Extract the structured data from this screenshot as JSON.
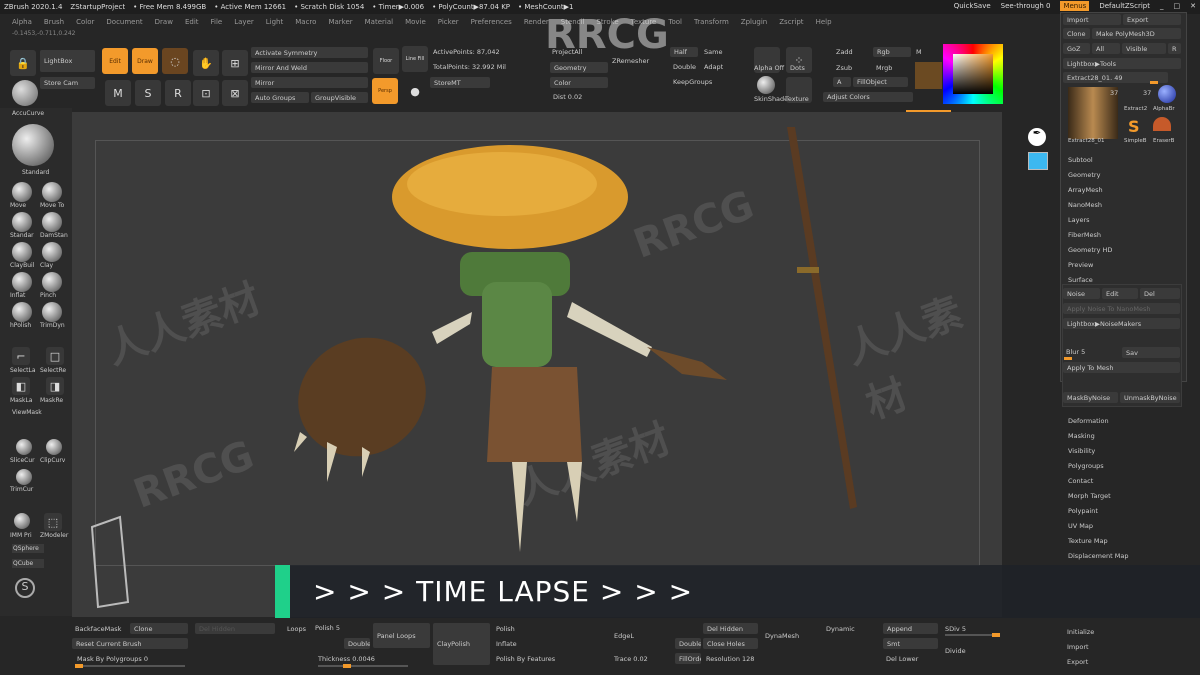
{
  "titlebar": {
    "app": "ZBrush 2020.1.4",
    "project": "ZStartupProject",
    "free_mem": "• Free Mem 8.499GB",
    "active_mem": "• Active Mem 12661",
    "scratch": "• Scratch Disk 1054",
    "timer": "• Timer▶0.006",
    "polycount": "• PolyCount▶87.04 KP",
    "meshcount": "• MeshCount▶1",
    "quicksave": "QuickSave",
    "seethrough": "See-through 0",
    "menus": "Menus",
    "script": "DefaultZScript"
  },
  "menubar": [
    "Alpha",
    "Brush",
    "Color",
    "Document",
    "Draw",
    "Edit",
    "File",
    "Layer",
    "Light",
    "Macro",
    "Marker",
    "Material",
    "Movie",
    "Picker",
    "Preferences",
    "Render",
    "Stencil",
    "Stroke",
    "Texture",
    "Tool",
    "Transform",
    "Zplugin",
    "Zscript",
    "Help"
  ],
  "coords": "-0.1453,-0.711,0.242",
  "toolbar": {
    "lightbox": "LightBox",
    "store_cam": "Store Cam",
    "edit": "Edit",
    "draw": "Draw",
    "activate_symmetry": "Activate Symmetry",
    "mirror_weld": "Mirror And Weld",
    "mirror": "Mirror",
    "auto_groups": "Auto Groups",
    "group_visible": "GroupVisible",
    "floor": "Floor",
    "line_fill": "Line Fill",
    "persp": "Persp",
    "active_points": "ActivePoints: 87,042",
    "total_points": "TotalPoints: 32.992 Mil",
    "store_mt": "StoreMT",
    "project_all": "ProjectAll",
    "geometry": "Geometry",
    "color": "Color",
    "dist": "Dist 0.02",
    "zremesher": "ZRemesher",
    "half": "Half",
    "same": "Same",
    "double": "Double",
    "adapt": "Adapt",
    "keepgroups": "KeepGroups",
    "alpha": "Alpha Off",
    "dots": "Dots",
    "matcap": "SkinShade",
    "texture": "Texture",
    "zadd": "Zadd",
    "zsub": "Zsub",
    "rgb": "Rgb",
    "m": "M",
    "mrgb": "Mrgb",
    "a": "A",
    "fillobject": "FillObject",
    "adjust_colors": "Adjust Colors"
  },
  "right_panel": {
    "import": "Import",
    "export": "Export",
    "clone": "Clone",
    "make_polymesh": "Make PolyMesh3D",
    "goz": "GoZ",
    "all": "All",
    "visible": "Visible",
    "r": "R",
    "lightbox_tools": "Lightbox▶Tools",
    "extract_slider": "Extract28_01. 49",
    "subtool_count_1": "37",
    "subtool_count_2": "37",
    "thumb_1": "Extract28_01",
    "thumb_2": "Extract2",
    "thumb_3": "AlphaBr",
    "thumb_4": "SimpleB",
    "thumb_5": "EraserB"
  },
  "right_menu_top": [
    "Subtool",
    "Geometry",
    "ArrayMesh",
    "NanoMesh",
    "Layers",
    "FiberMesh",
    "Geometry HD",
    "Preview",
    "Surface"
  ],
  "surface": {
    "noise": "Noise",
    "edit": "Edit",
    "del": "Del",
    "apply_noise": "Apply Noise To NanoMesh",
    "lightbox_noise": "Lightbox▶NoiseMakers",
    "blur": "Blur 5",
    "save": "Sav",
    "apply_mesh": "Apply To Mesh",
    "mask_noise": "MaskByNoise",
    "unmask": "UnmaskByNoise"
  },
  "right_menu_bottom": [
    "Deformation",
    "Masking",
    "Visibility",
    "Polygroups",
    "Contact",
    "Morph Target",
    "Polypaint",
    "UV Map",
    "Texture Map",
    "Displacement Map"
  ],
  "shelf": {
    "title": "AccuCurve",
    "main": "Standard",
    "brushes": [
      "Move",
      "Move To",
      "Standar",
      "DamStan",
      "ClayBuil",
      "Clay",
      "Inflat",
      "Pinch",
      "hPolish",
      "TrimDyn"
    ],
    "select": [
      "SelectLa",
      "SelectRe"
    ],
    "mask": [
      "MaskLa",
      "MaskRe"
    ],
    "viewmask": "ViewMask",
    "cut": [
      "SliceCur",
      "ClipCurv"
    ],
    "trimcurve": "TrimCur",
    "insert": [
      "IMM Pri",
      "ZModeler"
    ],
    "qsphere": "QSphere",
    "qcube": "QCube"
  },
  "timelapse": "> > > TIME LAPSE > > >",
  "bottom": {
    "backface": "BackfaceMask",
    "clone": "Clone",
    "reset": "Reset Current Brush",
    "mask_poly": "Mask By Polygroups 0",
    "del_hidden_1": "Del Hidden",
    "panel_loops": "Panel Loops",
    "loops": "Loops",
    "polish": "Polish 5",
    "double": "Double",
    "thickness": "Thickness 0.0046",
    "claypolish": "ClayPolish",
    "polish2": "Polish",
    "inflate": "Inflate",
    "polish_features": "Polish By Features",
    "dyn_trace": "Trace 0.02",
    "edge": "EdgeL",
    "dyn_double": "Double",
    "fill": "FillOrde",
    "del_hidden": "Del Hidden",
    "close_holes": "Close Holes",
    "resolution": "Resolution 128",
    "dynamesh": "DynaMesh",
    "dynamic": "Dynamic",
    "append": "Append",
    "smt": "Smt",
    "del_lower": "Del Lower",
    "sdiv": "SDiv 5",
    "divide": "Divide",
    "initialize": "Initialize",
    "import": "Import",
    "export": "Export"
  },
  "watermarks": [
    "RRCG",
    "人人素材"
  ],
  "colors": {
    "accent": "#f39a2b",
    "green": "#1fd08a",
    "picker": "#6b4a22"
  }
}
